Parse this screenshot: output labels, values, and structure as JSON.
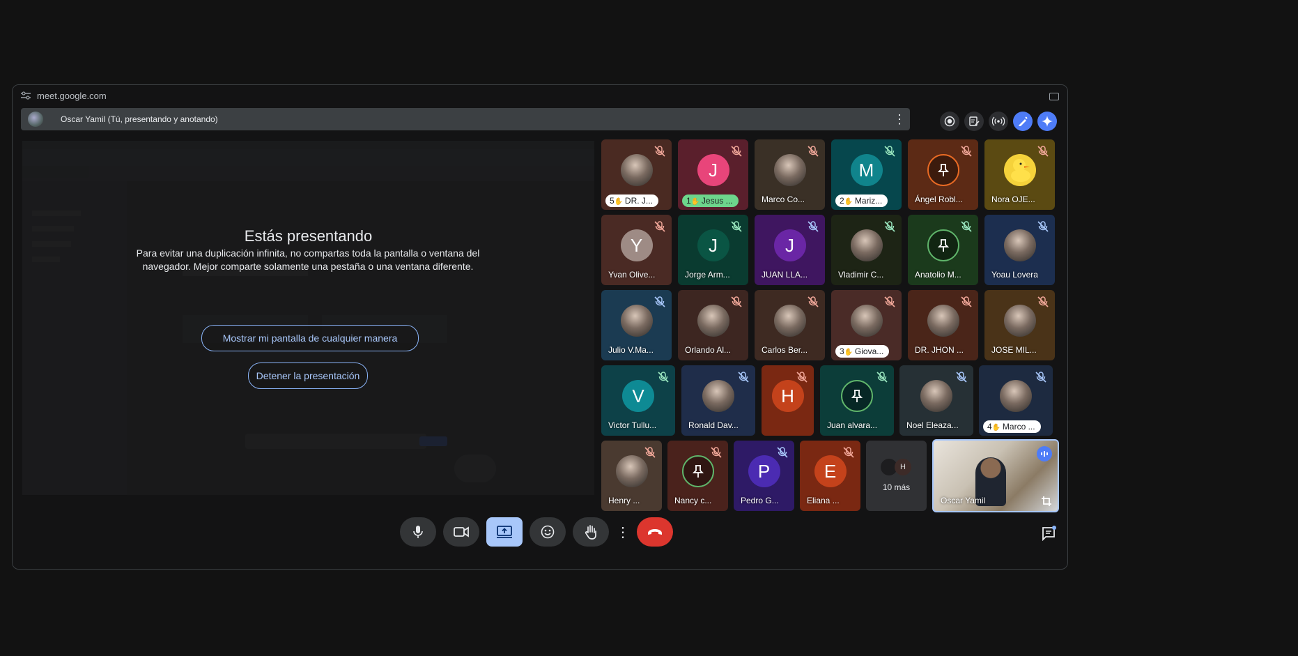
{
  "browser": {
    "url": "meet.google.com"
  },
  "presenting_bar": {
    "label": "Oscar Yamil (Tú, presentando y anotando)"
  },
  "presentation": {
    "title": "Estás presentando",
    "body": "Para evitar una duplicación infinita, no compartas toda la pantalla o ventana del navegador. Mejor comparte solamente una pestaña o una ventana diferente.",
    "show_anyway": "Mostrar mi pantalla de cualquier manera",
    "stop": "Detener la presentación"
  },
  "participants": [
    {
      "name": "DR. J...",
      "hand": "5",
      "bg": "#4a2a22",
      "avatar": "photo",
      "mic": "muted"
    },
    {
      "name": "Jesus ...",
      "hand": "1",
      "bg": "#5a1f2c",
      "avatar": "J",
      "avatar_color": "#e8457a",
      "mic": "muted",
      "green": true
    },
    {
      "name": "Marco Co...",
      "bg": "#3a3026",
      "avatar": "photo",
      "mic": "muted"
    },
    {
      "name": "Mariz...",
      "hand": "2",
      "bg": "#06474d",
      "avatar": "M",
      "avatar_color": "#10848c",
      "mic": "muted"
    },
    {
      "name": "Ángel Robl...",
      "bg": "#5c2a15",
      "avatar": "pin",
      "mic": "muted"
    },
    {
      "name": "Nora OJE...",
      "bg": "#5b4a12",
      "avatar": "duck",
      "mic": "muted"
    },
    {
      "name": "Yvan Olive...",
      "bg": "#4a2a24",
      "avatar": "Y",
      "avatar_color": "#9e8b85",
      "mic": "muted"
    },
    {
      "name": "Jorge Arm...",
      "bg": "#0a3b30",
      "avatar": "J",
      "avatar_color": "#0a5544",
      "mic": "muted"
    },
    {
      "name": "JUAN LLA...",
      "bg": "#3f1660",
      "avatar": "J",
      "avatar_color": "#6a26a5",
      "mic": "muted"
    },
    {
      "name": "Vladimir C...",
      "bg": "#1d2415",
      "avatar": "photo",
      "mic": "muted"
    },
    {
      "name": "Anatolio M...",
      "bg": "#1b3a1c",
      "avatar": "pin",
      "mic": "muted"
    },
    {
      "name": "Yoau Lovera",
      "bg": "#1c2e4f",
      "avatar": "photo",
      "mic": "muted"
    },
    {
      "name": "Julio V.Ma...",
      "bg": "#1b3b52",
      "avatar": "photo",
      "mic": "muted"
    },
    {
      "name": "Orlando Al...",
      "bg": "#3d2621",
      "avatar": "photo",
      "mic": "muted"
    },
    {
      "name": "Carlos Ber...",
      "bg": "#3e2a22",
      "avatar": "photo",
      "mic": "muted"
    },
    {
      "name": "Giova...",
      "hand": "3",
      "bg": "#4a2b27",
      "avatar": "photo",
      "mic": "muted"
    },
    {
      "name": "DR. JHON ...",
      "bg": "#4a2519",
      "avatar": "photo",
      "mic": "muted"
    },
    {
      "name": "JOSE MIL...",
      "bg": "#4a3318",
      "avatar": "photo",
      "mic": "muted"
    },
    {
      "name": "Victor Tullu...",
      "bg": "#0d4148",
      "avatar": "V",
      "avatar_color": "#0e8a94",
      "mic": "muted"
    },
    {
      "name": "Ronald Dav...",
      "bg": "#1f2d4a",
      "avatar": "photo",
      "mic": "muted"
    },
    {
      "name": "",
      "bg": "#7a2812",
      "avatar": "H",
      "avatar_color": "#c4421b",
      "mic": "muted"
    },
    {
      "name": "Juan alvara...",
      "bg": "#0c3d39",
      "avatar": "pin",
      "mic": "muted"
    },
    {
      "name": "Noel Eleaza...",
      "bg": "#263035",
      "avatar": "photo",
      "mic": "muted"
    },
    {
      "name": "Marco ...",
      "hand": "4",
      "bg": "#1d2a40",
      "avatar": "photo",
      "mic": "muted"
    },
    {
      "name": "Henry ...",
      "bg": "#4a3a30",
      "avatar": "photo",
      "mic": "muted"
    },
    {
      "name": "Nancy c...",
      "bg": "#4a221c",
      "avatar": "pin",
      "mic": "muted"
    },
    {
      "name": "Pedro G...",
      "bg": "#2e1a66",
      "avatar": "P",
      "avatar_color": "#4b2bb2",
      "mic": "muted"
    },
    {
      "name": "Eliana ...",
      "bg": "#7a2812",
      "avatar": "E",
      "avatar_color": "#c4421b",
      "mic": "muted"
    }
  ],
  "more": {
    "label": "10 más",
    "initial": "H"
  },
  "self_tile": {
    "name": "Oscar Yamil"
  },
  "controls": {
    "mic": "mic-icon",
    "camera": "camera-icon",
    "present": "present-icon",
    "emoji": "emoji-icon",
    "raise_hand": "hand-icon",
    "more": "more-options-icon",
    "leave": "end-call-icon",
    "chat": "chat-icon"
  }
}
